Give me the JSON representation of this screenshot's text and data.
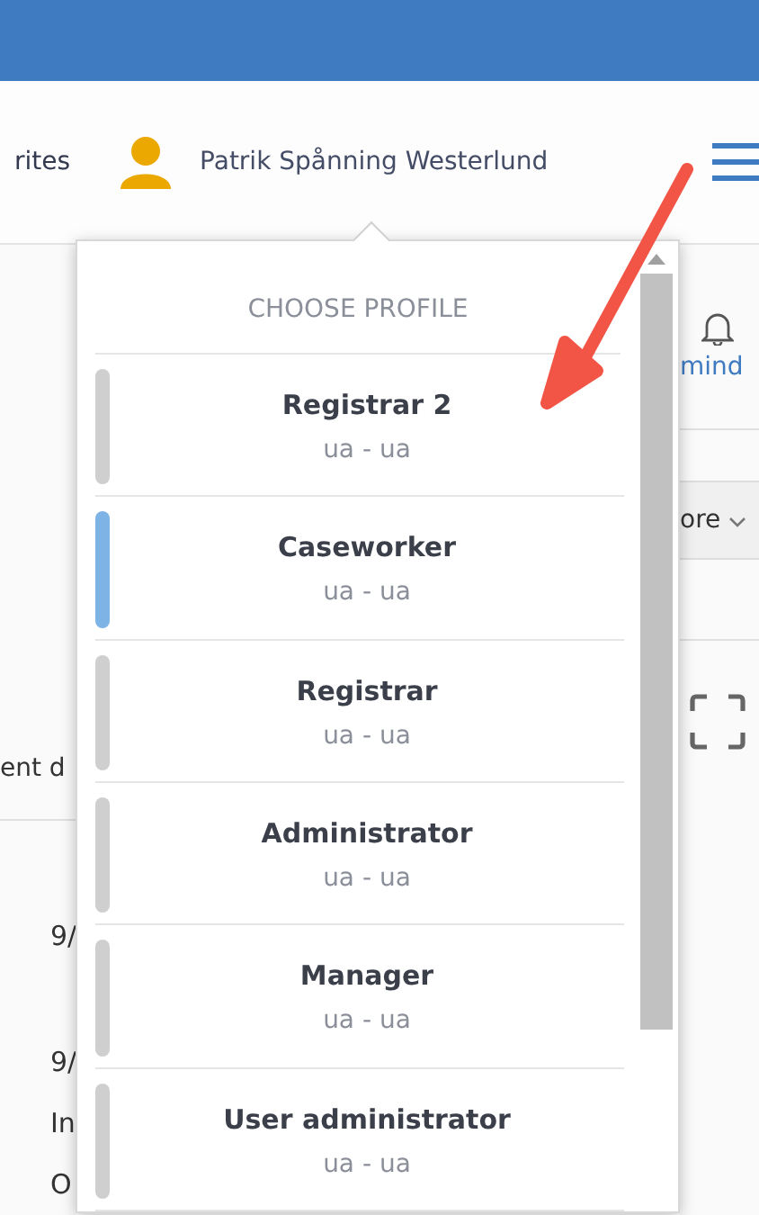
{
  "header": {
    "nav_link": "rites",
    "user_name": "Patrik Spånning Westerlund"
  },
  "background": {
    "reminders_label": "mind",
    "more_button": "ore",
    "column_header": "ent d",
    "cells": [
      "9/",
      "9/",
      "In",
      "O"
    ]
  },
  "profile_menu": {
    "title": "CHOOSE PROFILE",
    "profiles": [
      {
        "name": "Registrar 2",
        "detail": "ua - ua",
        "selected": false
      },
      {
        "name": "Caseworker",
        "detail": "ua - ua",
        "selected": true
      },
      {
        "name": "Registrar",
        "detail": "ua - ua",
        "selected": false
      },
      {
        "name": "Administrator",
        "detail": "ua - ua",
        "selected": false
      },
      {
        "name": "Manager",
        "detail": "ua - ua",
        "selected": false
      },
      {
        "name": "User administrator",
        "detail": "ua - ua",
        "selected": false
      }
    ]
  }
}
